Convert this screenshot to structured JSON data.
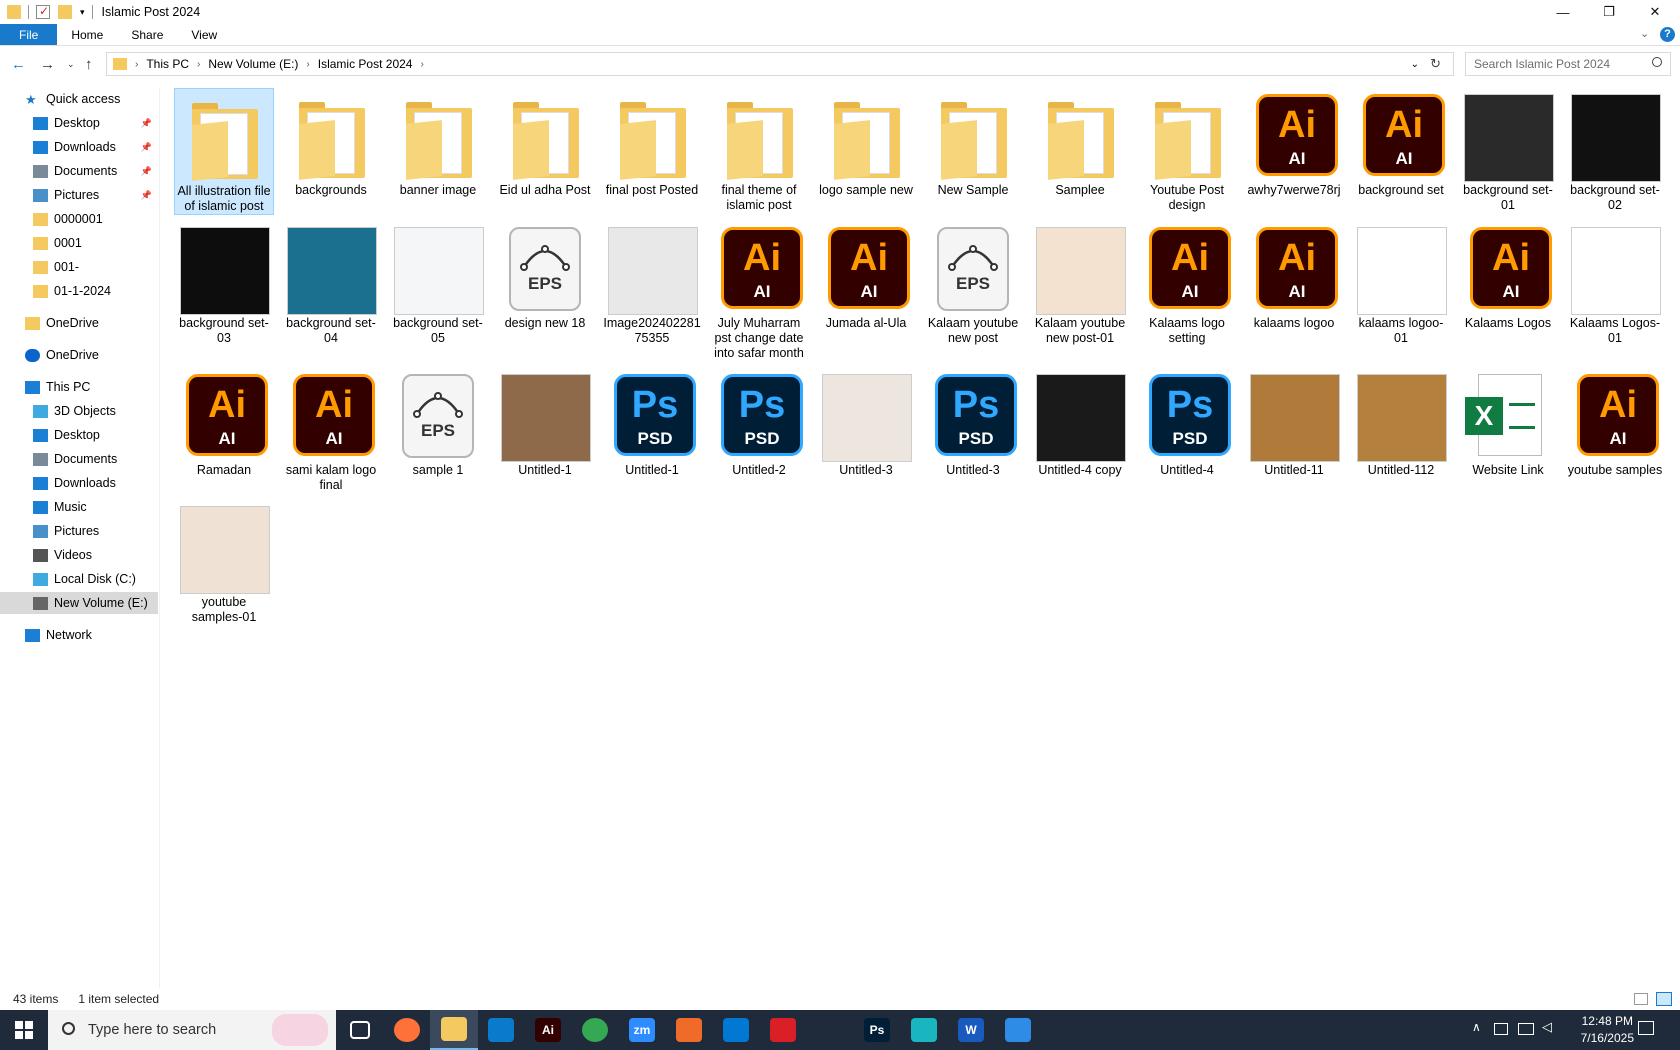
{
  "window": {
    "title": "Islamic Post 2024",
    "minimize_glyph": "—",
    "maximize_glyph": "❐",
    "close_glyph": "✕"
  },
  "ribbon": {
    "tabs": [
      {
        "label": "File"
      },
      {
        "label": "Home"
      },
      {
        "label": "Share"
      },
      {
        "label": "View"
      }
    ],
    "help_glyph": "?"
  },
  "address": {
    "crumbs": [
      "This PC",
      "New Volume (E:)",
      "Islamic Post 2024"
    ],
    "search_placeholder": "Search Islamic Post 2024"
  },
  "sidebar": {
    "items": [
      {
        "label": "Quick access",
        "icon": "star-icon",
        "color": "#1979ca",
        "indent": 0
      },
      {
        "label": "Desktop",
        "icon": "desktop-icon",
        "color": "#1c7fd6",
        "indent": 1,
        "pinned": true
      },
      {
        "label": "Downloads",
        "icon": "download-icon",
        "color": "#1c7fd6",
        "indent": 1,
        "pinned": true
      },
      {
        "label": "Documents",
        "icon": "document-icon",
        "color": "#7a8a9a",
        "indent": 1,
        "pinned": true
      },
      {
        "label": "Pictures",
        "icon": "pictures-icon",
        "color": "#4a90c8",
        "indent": 1,
        "pinned": true
      },
      {
        "label": "0000001",
        "icon": "folder-icon",
        "color": "#f3c960",
        "indent": 1
      },
      {
        "label": "0001",
        "icon": "folder-icon",
        "color": "#f3c960",
        "indent": 1
      },
      {
        "label": "001-",
        "icon": "folder-icon",
        "color": "#f3c960",
        "indent": 1
      },
      {
        "label": "01-1-2024",
        "icon": "folder-icon",
        "color": "#f3c960",
        "indent": 1
      },
      {
        "label": "OneDrive",
        "icon": "folder-icon",
        "color": "#f3c960",
        "indent": 0
      },
      {
        "label": "OneDrive",
        "icon": "cloud-icon",
        "color": "#0a64c9",
        "indent": 0
      },
      {
        "label": "This PC",
        "icon": "computer-icon",
        "color": "#1c7fd6",
        "indent": 0
      },
      {
        "label": "3D Objects",
        "icon": "cube-icon",
        "color": "#3fa9e0",
        "indent": 1
      },
      {
        "label": "Desktop",
        "icon": "desktop-icon",
        "color": "#1c7fd6",
        "indent": 1
      },
      {
        "label": "Documents",
        "icon": "document-icon",
        "color": "#7a8a9a",
        "indent": 1
      },
      {
        "label": "Downloads",
        "icon": "download-icon",
        "color": "#1c7fd6",
        "indent": 1
      },
      {
        "label": "Music",
        "icon": "music-icon",
        "color": "#1c7fd6",
        "indent": 1
      },
      {
        "label": "Pictures",
        "icon": "pictures-icon",
        "color": "#4a90c8",
        "indent": 1
      },
      {
        "label": "Videos",
        "icon": "video-icon",
        "color": "#555",
        "indent": 1
      },
      {
        "label": "Local Disk (C:)",
        "icon": "drive-icon",
        "color": "#3fa9e0",
        "indent": 1
      },
      {
        "label": "New Volume (E:)",
        "icon": "drive-icon",
        "color": "#666",
        "indent": 1,
        "selected": true
      },
      {
        "label": "Network",
        "icon": "network-icon",
        "color": "#1c7fd6",
        "indent": 0
      }
    ]
  },
  "files": [
    {
      "name": "All illustration file of islamic post",
      "type": "folder",
      "selected": true
    },
    {
      "name": "backgrounds",
      "type": "folder"
    },
    {
      "name": "banner image",
      "type": "folder"
    },
    {
      "name": "Eid ul adha Post",
      "type": "folder"
    },
    {
      "name": "final post Posted",
      "type": "folder"
    },
    {
      "name": "final theme of islamic post",
      "type": "folder"
    },
    {
      "name": "logo sample new",
      "type": "folder"
    },
    {
      "name": "New Sample",
      "type": "folder"
    },
    {
      "name": "Samplee",
      "type": "folder"
    },
    {
      "name": "Youtube Post design",
      "type": "folder"
    },
    {
      "name": "awhy7werwe78rj",
      "type": "ai"
    },
    {
      "name": "background set",
      "type": "ai"
    },
    {
      "name": "background set-01",
      "type": "img",
      "bg": "#2a2a2a"
    },
    {
      "name": "background set-02",
      "type": "img",
      "bg": "#111111"
    },
    {
      "name": "background set-03",
      "type": "img",
      "bg": "#0d0d0d"
    },
    {
      "name": "background set-04",
      "type": "img",
      "bg": "#1b6f8f"
    },
    {
      "name": "background set-05",
      "type": "img",
      "bg": "#f4f6f8"
    },
    {
      "name": "design new 18",
      "type": "eps"
    },
    {
      "name": "Image20240228175355",
      "type": "img",
      "bg": "#e8e8e8"
    },
    {
      "name": "July Muharram pst change date into safar month",
      "type": "ai"
    },
    {
      "name": "Jumada al-Ula",
      "type": "ai"
    },
    {
      "name": "Kalaam youtube new post",
      "type": "eps"
    },
    {
      "name": "Kalaam youtube new post-01",
      "type": "img",
      "bg": "#f3e2cf"
    },
    {
      "name": "Kalaams logo setting",
      "type": "ai"
    },
    {
      "name": "kalaams logoo",
      "type": "ai"
    },
    {
      "name": "kalaams logoo-01",
      "type": "img",
      "bg": "#ffffff"
    },
    {
      "name": "Kalaams Logos",
      "type": "ai"
    },
    {
      "name": "Kalaams Logos-01",
      "type": "img",
      "bg": "#ffffff"
    },
    {
      "name": "Ramadan",
      "type": "ai"
    },
    {
      "name": "sami kalam logo final",
      "type": "ai"
    },
    {
      "name": "sample 1",
      "type": "eps"
    },
    {
      "name": "Untitled-1",
      "type": "img",
      "bg": "#8f6a4a"
    },
    {
      "name": "Untitled-1",
      "type": "psd"
    },
    {
      "name": "Untitled-2",
      "type": "psd"
    },
    {
      "name": "Untitled-3",
      "type": "img",
      "bg": "#ece6df"
    },
    {
      "name": "Untitled-3",
      "type": "psd"
    },
    {
      "name": "Untitled-4 copy",
      "type": "img",
      "bg": "#1a1a1a"
    },
    {
      "name": "Untitled-4",
      "type": "psd"
    },
    {
      "name": "Untitled-11",
      "type": "img",
      "bg": "#b07a3a"
    },
    {
      "name": "Untitled-112",
      "type": "img",
      "bg": "#b4803e"
    },
    {
      "name": "Website Link",
      "type": "xls"
    },
    {
      "name": "youtube samples",
      "type": "ai"
    },
    {
      "name": "youtube samples-01",
      "type": "img",
      "bg": "#efe2d4"
    }
  ],
  "file_labels": {
    "ai_big": "Ai",
    "ai_small": "AI",
    "psd_big": "Ps",
    "psd_small": "PSD",
    "eps_small": "EPS",
    "xls_letter": "X",
    "folder_mark": "Ai"
  },
  "status": {
    "items_count": "43 items",
    "selection": "1 item selected"
  },
  "taskbar": {
    "search_placeholder": "Type here to search",
    "apps": [
      {
        "name": "task-view",
        "label": "",
        "color": "#1f2a3a"
      },
      {
        "name": "firefox",
        "label": "",
        "color": "#ff7139"
      },
      {
        "name": "file-explorer",
        "label": "",
        "color": "#f3c960",
        "active": true
      },
      {
        "name": "vscode",
        "label": "",
        "color": "#0a7acc"
      },
      {
        "name": "illustrator",
        "label": "Ai",
        "color": "#330000"
      },
      {
        "name": "chrome",
        "label": "",
        "color": "#34a853"
      },
      {
        "name": "zoom",
        "label": "zm",
        "color": "#2d8cff"
      },
      {
        "name": "app-orange",
        "label": "",
        "color": "#f06a2a"
      },
      {
        "name": "outlook",
        "label": "",
        "color": "#0078d4"
      },
      {
        "name": "creative-cloud",
        "label": "",
        "color": "#da1f26"
      },
      {
        "name": "pen-tool",
        "label": "",
        "color": "#1f2a3a"
      },
      {
        "name": "photoshop",
        "label": "Ps",
        "color": "#001e36"
      },
      {
        "name": "app-teal",
        "label": "",
        "color": "#1ab6c0"
      },
      {
        "name": "word",
        "label": "W",
        "color": "#185abd"
      },
      {
        "name": "paint",
        "label": "",
        "color": "#2e8be6"
      }
    ],
    "time": "12:48 PM",
    "date": "7/16/2025"
  }
}
